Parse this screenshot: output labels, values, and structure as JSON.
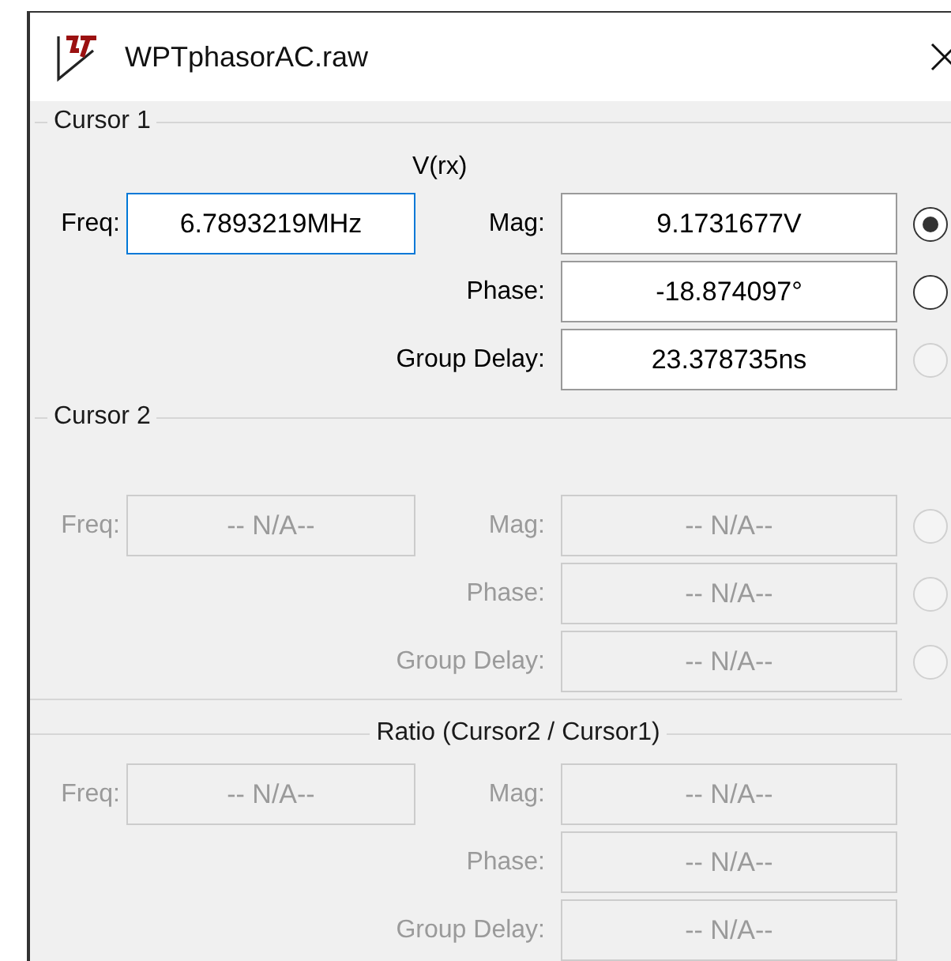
{
  "window": {
    "title": "WPTphasorAC.raw"
  },
  "sections": [
    {
      "kind": "cursor",
      "title": "Cursor 1",
      "signal": "V(rx)",
      "disabled": false,
      "freq": {
        "label": "Freq:",
        "value": "6.7893219MHz",
        "focused": true
      },
      "rows": [
        {
          "label": "Mag:",
          "value": "9.1731677V",
          "radio": {
            "selected": true,
            "disabled": false
          }
        },
        {
          "label": "Phase:",
          "value": "-18.874097°",
          "radio": {
            "selected": false,
            "disabled": false
          }
        },
        {
          "label": "Group Delay:",
          "value": "23.378735ns",
          "radio": {
            "selected": false,
            "disabled": true
          }
        }
      ]
    },
    {
      "kind": "cursor",
      "title": "Cursor 2",
      "disabled": true,
      "freq": {
        "label": "Freq:",
        "value": "-- N/A--",
        "focused": false
      },
      "rows": [
        {
          "label": "Mag:",
          "value": "-- N/A--",
          "radio": {
            "selected": false,
            "disabled": true
          }
        },
        {
          "label": "Phase:",
          "value": "-- N/A--",
          "radio": {
            "selected": false,
            "disabled": true
          }
        },
        {
          "label": "Group Delay:",
          "value": "-- N/A--",
          "radio": {
            "selected": false,
            "disabled": true
          }
        }
      ]
    },
    {
      "kind": "ratio",
      "title": "Ratio (Cursor2 / Cursor1)",
      "disabled": true,
      "freq": {
        "label": "Freq:",
        "value": "-- N/A--",
        "focused": false
      },
      "rows": [
        {
          "label": "Mag:",
          "value": "-- N/A--"
        },
        {
          "label": "Phase:",
          "value": "-- N/A--"
        },
        {
          "label": "Group Delay:",
          "value": "-- N/A--"
        }
      ]
    }
  ]
}
